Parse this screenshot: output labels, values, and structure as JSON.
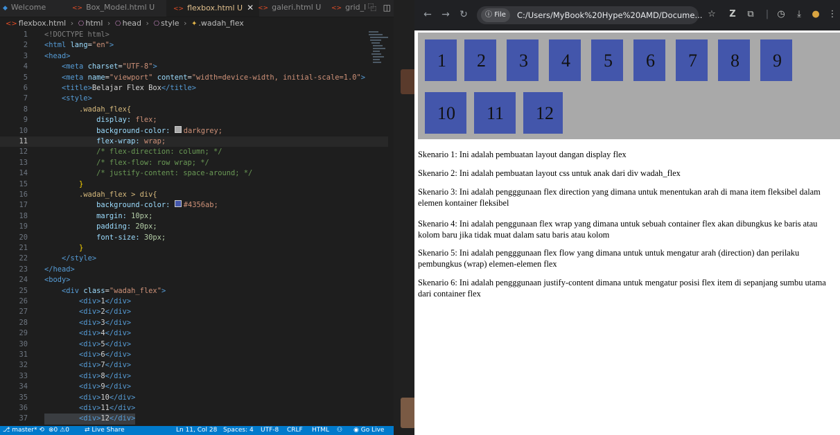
{
  "vscode": {
    "tabs": [
      {
        "label": "Welcome",
        "active": false
      },
      {
        "label": "Box_Model.html U",
        "active": false
      },
      {
        "label": "flexbox.html U",
        "active": true
      },
      {
        "label": "galeri.html U",
        "active": false
      },
      {
        "label": "grid_l",
        "active": false
      }
    ],
    "breadcrumb": [
      "flexbox.html",
      "html",
      "head",
      "style",
      ".wadah_flex"
    ],
    "current_line": 11,
    "lines": [
      {
        "n": "1"
      },
      {
        "n": "2"
      },
      {
        "n": "3"
      },
      {
        "n": "4"
      },
      {
        "n": "5"
      },
      {
        "n": "6"
      },
      {
        "n": "7"
      },
      {
        "n": "8"
      },
      {
        "n": "9"
      },
      {
        "n": "10"
      },
      {
        "n": "11"
      },
      {
        "n": "12"
      },
      {
        "n": "13"
      },
      {
        "n": "14"
      },
      {
        "n": "15"
      },
      {
        "n": "16"
      },
      {
        "n": "17"
      },
      {
        "n": "18"
      },
      {
        "n": "19"
      },
      {
        "n": "20"
      },
      {
        "n": "21"
      },
      {
        "n": "22"
      },
      {
        "n": "23"
      },
      {
        "n": "24"
      },
      {
        "n": "25"
      },
      {
        "n": "26"
      },
      {
        "n": "27"
      },
      {
        "n": "28"
      },
      {
        "n": "29"
      },
      {
        "n": "30"
      },
      {
        "n": "31"
      },
      {
        "n": "32"
      },
      {
        "n": "33"
      },
      {
        "n": "34"
      },
      {
        "n": "35"
      },
      {
        "n": "36"
      },
      {
        "n": "37"
      }
    ],
    "code": {
      "doctype": "<!DOCTYPE html>",
      "html_open_tag": "<html",
      "lang_attr": "lang",
      "lang_val": "\"en\"",
      "head_open": "<head>",
      "meta": "<meta",
      "charset_attr": "charset",
      "charset_val": "\"UTF-8\"",
      "name_attr": "name",
      "name_val": "\"viewport\"",
      "content_attr": "content",
      "content_val": "\"width=device-width, initial-scale=1.0\"",
      "title_open": "<title>",
      "title_text": "Belajar Flex Box",
      "title_close": "</title>",
      "style_open": "<style>",
      "sel1": ".wadah_flex{",
      "p_display": "display:",
      "v_display": "flex;",
      "p_bg": "background-color:",
      "v_bg": "darkgrey;",
      "p_wrap": "flex-wrap:",
      "v_wrap": "wrap;",
      "c1": "/* flex-direction: column; */",
      "c2": "/* flex-flow: row wrap; */",
      "c3": "/* justify-content: space-around; */",
      "close_brace": "}",
      "sel2": ".wadah_flex > div{",
      "p_bg2": "background-color:",
      "v_bg2": "#4356ab;",
      "p_margin": "margin:",
      "v_margin": "10px;",
      "p_padding": "padding:",
      "v_padding": "20px;",
      "p_font": "font-size:",
      "v_font": "30px;",
      "style_close": "</style>",
      "head_close": "</head>",
      "body_open": "<body>",
      "div_open": "<div",
      "class_attr": "class",
      "class_val": "\"wadah_flex\"",
      "gt": ">",
      "div_items": [
        "1",
        "2",
        "3",
        "4",
        "5",
        "6",
        "7",
        "8",
        "9",
        "10",
        "11",
        "12"
      ],
      "div_tag_open": "<div>",
      "div_tag_close": "</div>"
    },
    "status": {
      "branch": "master*",
      "errors": "0",
      "warnings": "0",
      "live_share": "Live Share",
      "position": "Ln 11, Col 28",
      "spaces": "Spaces: 4",
      "encoding": "UTF-8",
      "eol": "CRLF",
      "language": "HTML",
      "go_live": "Go Live"
    },
    "colors": {
      "darkgrey_swatch": "#a9a9a9",
      "blue_swatch": "#4356ab",
      "statusbar": "#007acc"
    }
  },
  "browser": {
    "file_chip": "File",
    "url": "C:/Users/MyBook%20Hype%20AMD/Docume...",
    "icons": [
      "back-icon",
      "forward-icon",
      "reload-icon",
      "info-icon",
      "star-icon",
      "extension-z-icon",
      "extensions-puzzle-icon",
      "history-icon",
      "download-icon",
      "profile-icon",
      "menu-icon"
    ],
    "flex_items": [
      "1",
      "2",
      "3",
      "4",
      "5",
      "6",
      "7",
      "8",
      "9",
      "10",
      "11",
      "12"
    ],
    "paragraphs": [
      "Skenario 1: Ini adalah pembuatan layout dangan display flex",
      "Skenario 2: Ini adalah pembuatan layout css untuk anak dari div wadah_flex",
      "Skenario 3: Ini adalah pengggunaan flex direction yang dimana untuk menentukan arah di mana item fleksibel dalam elemen kontainer fleksibel",
      "Skenario 4: Ini adalah penggunaan flex wrap yang dimana untuk sebuah container flex akan dibungkus ke baris atau kolom baru jika tidak muat dalam satu baris atau kolom",
      "Skenario 5: Ini adalah pengggunaan flex flow yang dimana untuk untuk mengatur arah (direction) dan perilaku pembungkus (wrap) elemen-elemen flex",
      "Skenario 6: Ini adalah pengggunaan justify-content dimana untuk mengatur posisi flex item di sepanjang sumbu utama dari container flex"
    ],
    "colors": {
      "container": "#a9a9a9",
      "item": "#4356ab"
    }
  }
}
